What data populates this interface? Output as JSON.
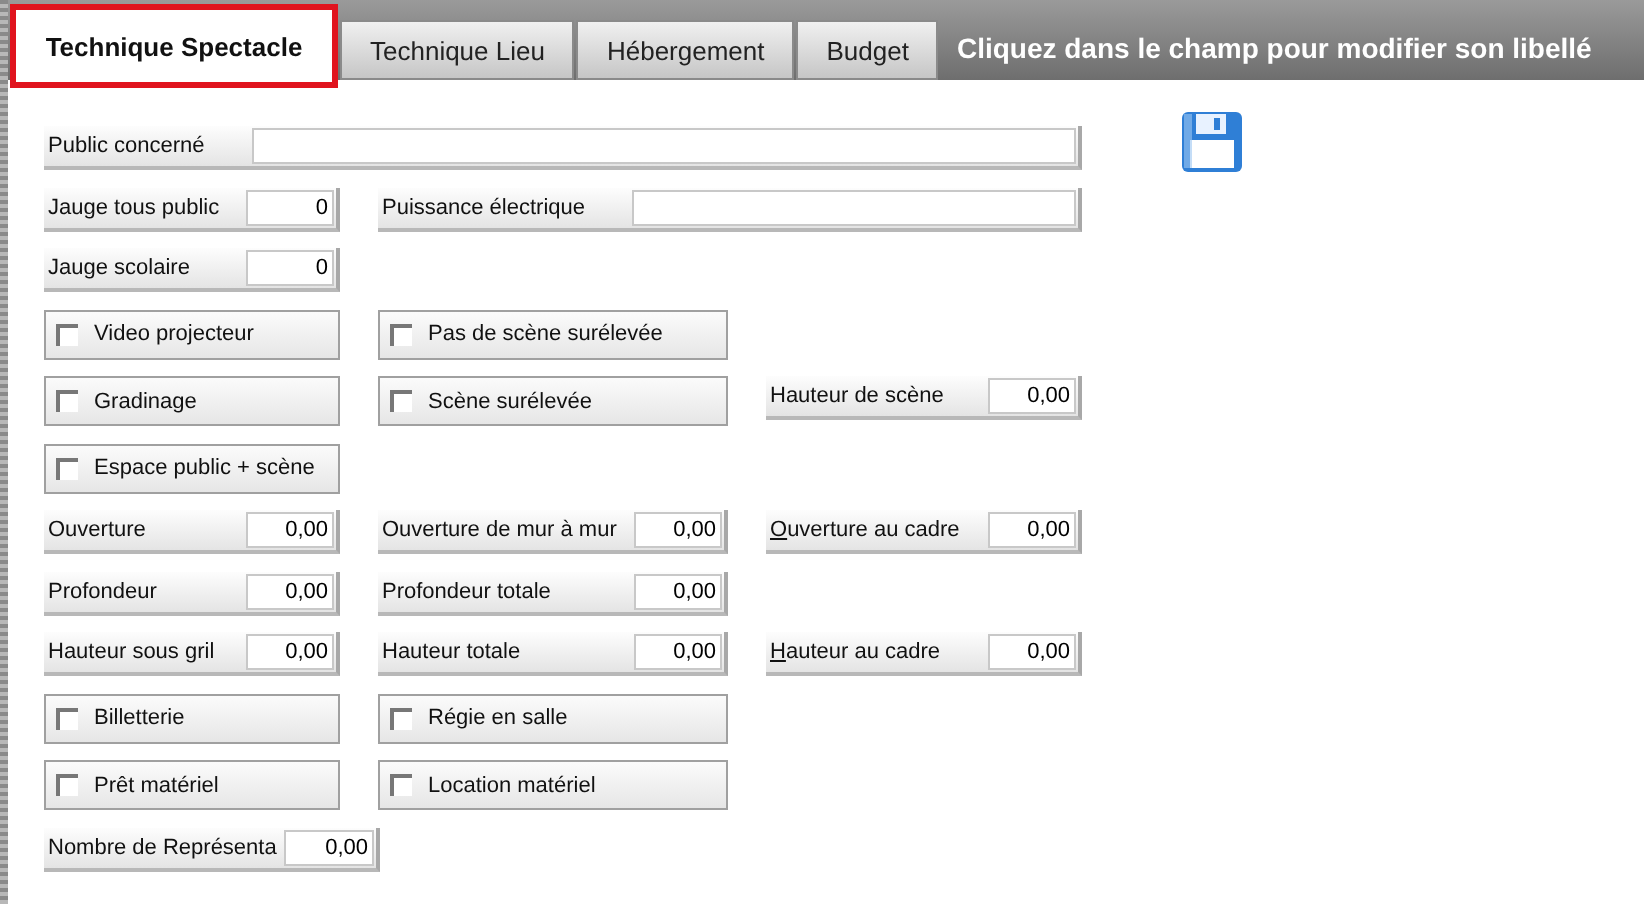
{
  "tabs": [
    {
      "label": "Technique Spectacle",
      "selected": true
    },
    {
      "label": "Technique Lieu",
      "selected": false
    },
    {
      "label": "Hébergement",
      "selected": false
    },
    {
      "label": "Budget",
      "selected": false
    }
  ],
  "hint": "Cliquez dans le champ pour modifier son libellé",
  "form": {
    "rows": [
      {
        "items": [
          {
            "kind": "wide_field",
            "label": "Public concerné"
          }
        ]
      },
      {
        "items": [
          {
            "kind": "field",
            "label": "Jauge tous public",
            "value": "0"
          },
          {
            "kind": "double_field",
            "label": "Puissance électrique"
          }
        ]
      },
      {
        "items": [
          {
            "kind": "field",
            "label": "Jauge scolaire",
            "value": "0"
          }
        ]
      },
      {
        "items": [
          {
            "kind": "checkbox",
            "label": "Video projecteur",
            "checked": false
          },
          {
            "kind": "checkbox",
            "label": "Pas de scène surélevée",
            "checked": false
          }
        ]
      },
      {
        "items": [
          {
            "kind": "checkbox",
            "label": "Gradinage",
            "checked": false
          },
          {
            "kind": "checkbox",
            "label": "Scène surélevée",
            "checked": false
          },
          {
            "kind": "field",
            "label": "Hauteur de scène",
            "value": "0,00"
          }
        ]
      },
      {
        "items": [
          {
            "kind": "checkbox",
            "label": "Espace public + scène",
            "checked": false
          }
        ]
      },
      {
        "items": [
          {
            "kind": "field",
            "label": "Ouverture",
            "value": "0,00"
          },
          {
            "kind": "field",
            "label": "Ouverture de mur à mur",
            "value": "0,00"
          },
          {
            "kind": "field",
            "label": "Ouverture au cadre",
            "value": "0,00",
            "shortcut": true
          }
        ]
      },
      {
        "items": [
          {
            "kind": "field",
            "label": "Profondeur",
            "value": "0,00"
          },
          {
            "kind": "field",
            "label": "Profondeur totale",
            "value": "0,00"
          }
        ]
      },
      {
        "items": [
          {
            "kind": "field",
            "label": "Hauteur sous gril",
            "value": "0,00"
          },
          {
            "kind": "field",
            "label": "Hauteur totale",
            "value": "0,00"
          },
          {
            "kind": "field",
            "label": "Hauteur au cadre",
            "value": "0,00",
            "shortcut": true
          }
        ]
      },
      {
        "items": [
          {
            "kind": "checkbox",
            "label": "Billetterie",
            "checked": false
          },
          {
            "kind": "checkbox",
            "label": "Régie en salle",
            "checked": false
          }
        ]
      },
      {
        "items": [
          {
            "kind": "checkbox",
            "label": "Prêt matériel",
            "checked": false
          },
          {
            "kind": "checkbox",
            "label": "Location matériel",
            "checked": false
          }
        ]
      },
      {
        "items": [
          {
            "kind": "long_field",
            "label": "Nombre de Représenta",
            "value": "0,00"
          }
        ]
      }
    ]
  }
}
